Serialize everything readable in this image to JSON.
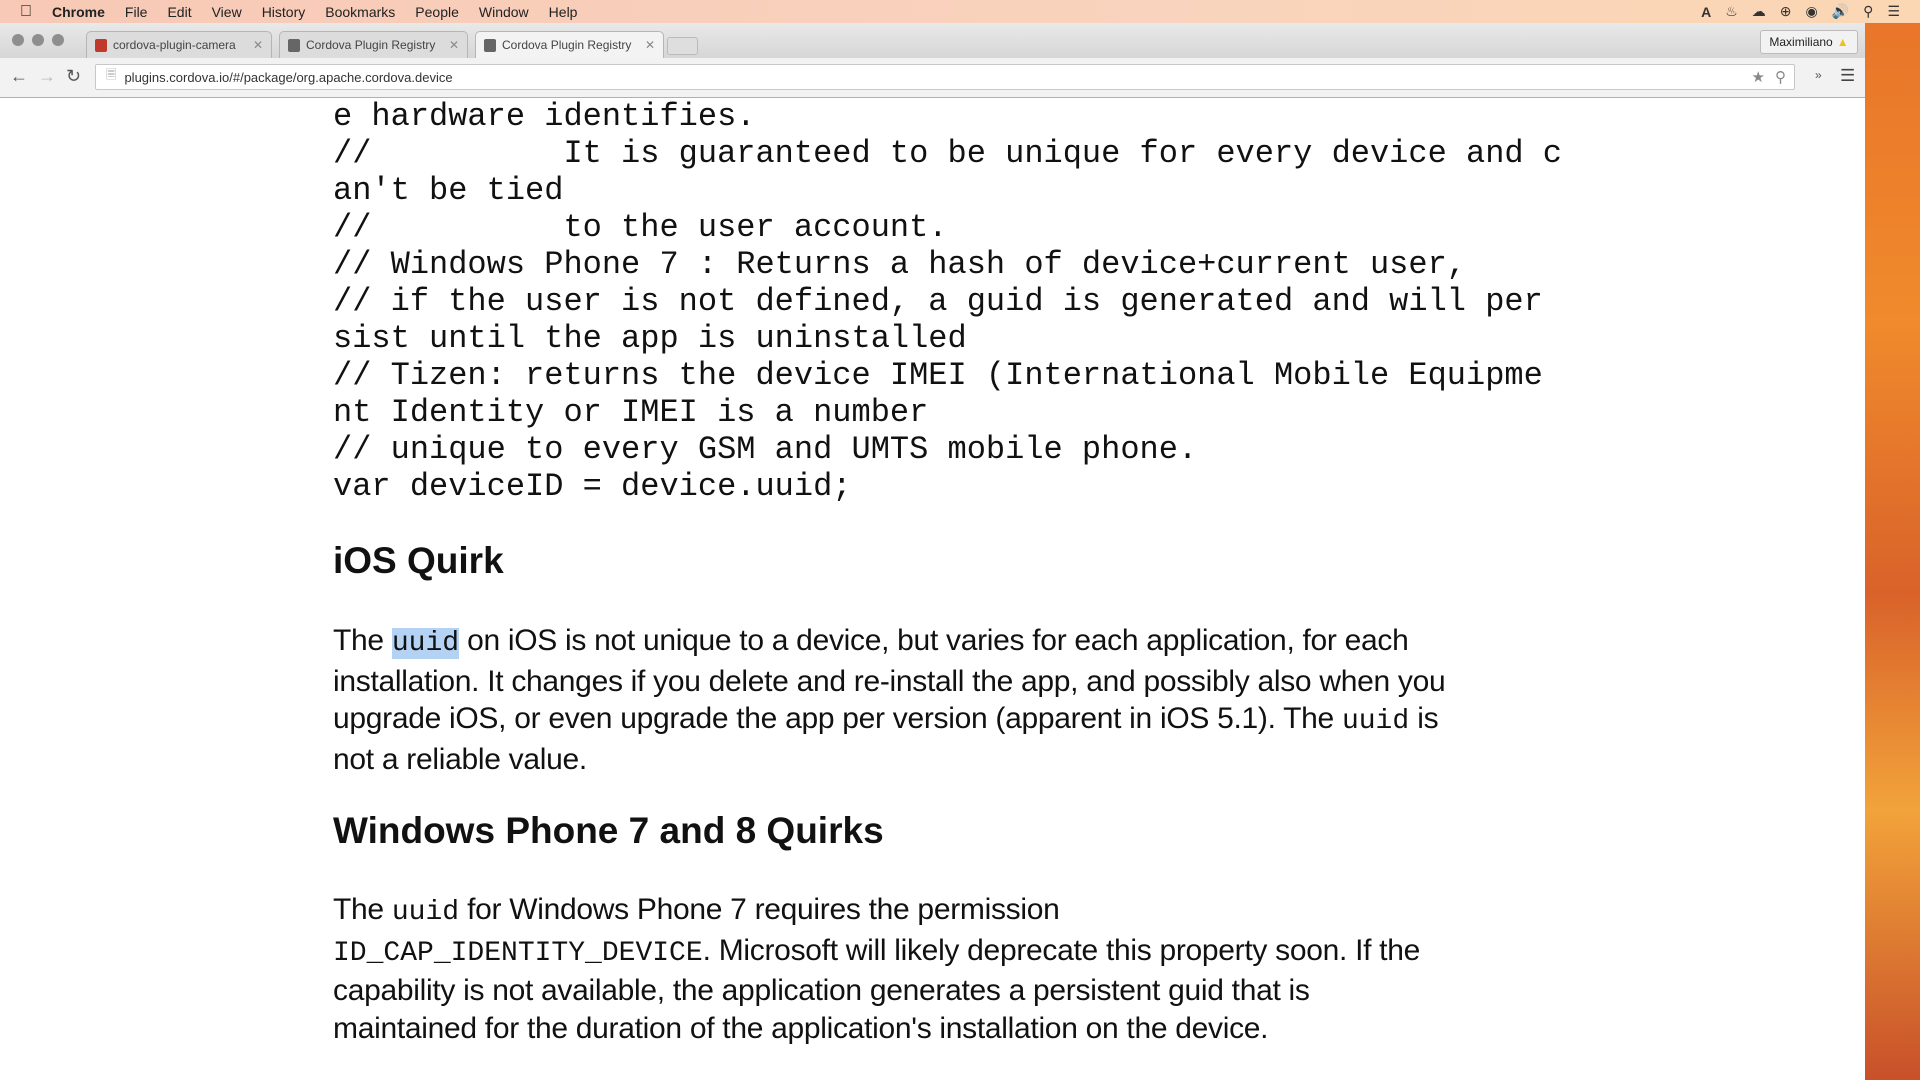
{
  "menubar": {
    "app": "Chrome",
    "items": [
      "File",
      "Edit",
      "View",
      "History",
      "Bookmarks",
      "People",
      "Window",
      "Help"
    ]
  },
  "tabs": [
    {
      "title": "cordova-plugin-camera",
      "active": false
    },
    {
      "title": "Cordova Plugin Registry",
      "active": false
    },
    {
      "title": "Cordova Plugin Registry",
      "active": true
    }
  ],
  "profile": {
    "name": "Maximiliano"
  },
  "address": {
    "url": "plugins.cordova.io/#/package/org.apache.cordova.device"
  },
  "code_lines": [
    "e hardware identifies.",
    "//          It is guaranteed to be unique for every device and c",
    "an't be tied",
    "//          to the user account.",
    "// Windows Phone 7 : Returns a hash of device+current user,",
    "// if the user is not defined, a guid is generated and will per",
    "sist until the app is uninstalled",
    "// Tizen: returns the device IMEI (International Mobile Equipme",
    "nt Identity or IMEI is a number",
    "// unique to every GSM and UMTS mobile phone.",
    "var deviceID = device.uuid;"
  ],
  "ios": {
    "heading": "iOS Quirk",
    "lines": [
      [
        {
          "t": "The "
        },
        {
          "c": "uuid",
          "sel": true
        },
        {
          "t": " on iOS is not unique to a device, but varies for each application, for each"
        }
      ],
      [
        {
          "t": "installation. It changes if you delete and re-install the app, and possibly also when you"
        }
      ],
      [
        {
          "t": "upgrade iOS, or even upgrade the app per version (apparent in iOS 5.1). The "
        },
        {
          "c": "uuid"
        },
        {
          "t": " is"
        }
      ],
      [
        {
          "t": "not a reliable value."
        }
      ]
    ]
  },
  "wp": {
    "heading": "Windows Phone 7 and 8 Quirks",
    "lines": [
      [
        {
          "t": "The "
        },
        {
          "c": "uuid"
        },
        {
          "t": " for Windows Phone 7 requires the permission"
        }
      ],
      [
        {
          "c": "ID_CAP_IDENTITY_DEVICE"
        },
        {
          "t": ". Microsoft will likely deprecate this property soon. If the"
        }
      ],
      [
        {
          "t": "capability is not available, the application generates a persistent guid that is"
        }
      ],
      [
        {
          "t": "maintained for the duration of the application's installation on the device."
        }
      ]
    ]
  }
}
